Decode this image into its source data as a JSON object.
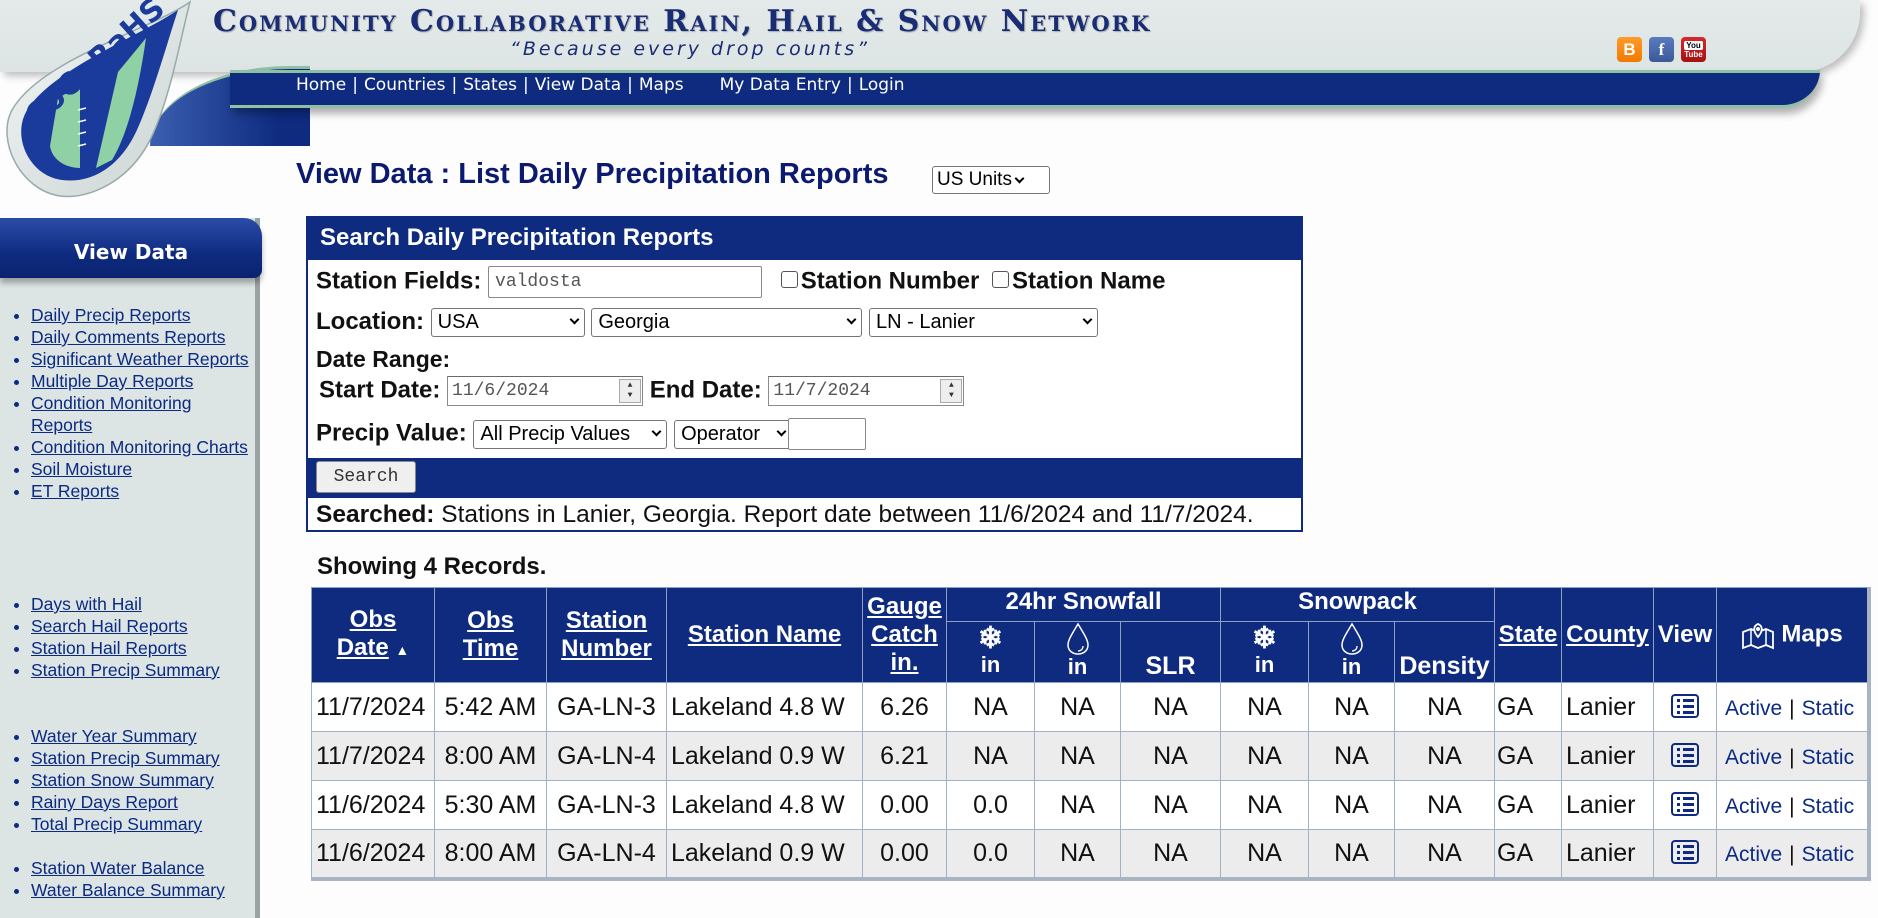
{
  "header": {
    "logo_text": "CoCoRaHS",
    "site_title": "Community Collaborative Rain, Hail & Snow Network",
    "tagline": "“Because every drop counts”",
    "nav_left": [
      "Home",
      "Countries",
      "States",
      "View Data",
      "Maps"
    ],
    "nav_right": [
      "My Data Entry",
      "Login"
    ],
    "social": [
      {
        "name": "blogger",
        "glyph": "B"
      },
      {
        "name": "facebook",
        "glyph": "f"
      },
      {
        "name": "youtube",
        "top": "You",
        "bottom": "Tube"
      }
    ]
  },
  "sidebar": {
    "title": "View Data",
    "groups": [
      [
        "Daily Precip Reports",
        "Daily Comments Reports",
        "Significant Weather Reports",
        "Multiple Day Reports",
        "Condition Monitoring Reports",
        "Condition Monitoring Charts",
        "Soil Moisture",
        "ET Reports"
      ],
      [
        "Days with Hail",
        "Search Hail Reports",
        "Station Hail Reports",
        "Station Precip Summary"
      ],
      [
        "Water Year Summary",
        "Station Precip Summary",
        "Station Snow Summary",
        "Rainy Days Report",
        "Total Precip Summary"
      ],
      [
        "Station Water Balance",
        "Water Balance Summary"
      ]
    ]
  },
  "page": {
    "title": "View Data : List Daily Precipitation Reports",
    "units_select": "US Units"
  },
  "search": {
    "heading": "Search Daily Precipitation Reports",
    "station_fields_label": "Station Fields:",
    "station_fields_value": "valdosta",
    "station_number_label": "Station Number",
    "station_number_checked": false,
    "station_name_label": "Station Name",
    "station_name_checked": false,
    "location_label": "Location:",
    "country": "USA",
    "state": "Georgia",
    "county": "LN - Lanier",
    "date_range_label": "Date Range:",
    "start_date_label": "Start Date:",
    "start_date": "11/6/2024",
    "end_date_label": "End Date:",
    "end_date": "11/7/2024",
    "precip_value_label": "Precip Value:",
    "precip_value_select": "All Precip Values",
    "operator_select": "Operator",
    "precip_amount": "",
    "search_button": "Search",
    "searched_label": "Searched:",
    "searched_text": "Stations in Lanier, Georgia. Report date between 11/6/2024 and 11/7/2024."
  },
  "results": {
    "count_text": "Showing 4 Records.",
    "headers": {
      "obs_date_1": "Obs",
      "obs_date_2": "Date",
      "sort_indicator": "▲",
      "obs_time_1": "Obs",
      "obs_time_2": "Time",
      "station_number_1": "Station",
      "station_number_2": "Number",
      "station_name": "Station Name",
      "gauge_1": "Gauge",
      "gauge_2": "Catch",
      "gauge_3": "in.",
      "snowfall_group": "24hr Snowfall",
      "snowpack_group": "Snowpack",
      "unit_in": "in",
      "slr": "SLR",
      "density": "Density",
      "state": "State",
      "county": "County",
      "view": "View",
      "maps": "Maps"
    },
    "rows": [
      {
        "obs_date": "11/7/2024",
        "obs_time": "5:42 AM",
        "station_number": "GA-LN-3",
        "station_name": "Lakeland 4.8 W",
        "gauge_catch": "6.26",
        "snowfall_in": "NA",
        "snowfall_swe": "NA",
        "slr": "NA",
        "snowpack_in": "NA",
        "snowpack_swe": "NA",
        "density": "NA",
        "state": "GA",
        "county": "Lanier",
        "maps_active": "Active",
        "maps_static": "Static"
      },
      {
        "obs_date": "11/7/2024",
        "obs_time": "8:00 AM",
        "station_number": "GA-LN-4",
        "station_name": "Lakeland 0.9 W",
        "gauge_catch": "6.21",
        "snowfall_in": "NA",
        "snowfall_swe": "NA",
        "slr": "NA",
        "snowpack_in": "NA",
        "snowpack_swe": "NA",
        "density": "NA",
        "state": "GA",
        "county": "Lanier",
        "maps_active": "Active",
        "maps_static": "Static"
      },
      {
        "obs_date": "11/6/2024",
        "obs_time": "5:30 AM",
        "station_number": "GA-LN-3",
        "station_name": "Lakeland 4.8 W",
        "gauge_catch": "0.00",
        "snowfall_in": "0.0",
        "snowfall_swe": "NA",
        "slr": "NA",
        "snowpack_in": "NA",
        "snowpack_swe": "NA",
        "density": "NA",
        "state": "GA",
        "county": "Lanier",
        "maps_active": "Active",
        "maps_static": "Static"
      },
      {
        "obs_date": "11/6/2024",
        "obs_time": "8:00 AM",
        "station_number": "GA-LN-4",
        "station_name": "Lakeland 0.9 W",
        "gauge_catch": "0.00",
        "snowfall_in": "0.0",
        "snowfall_swe": "NA",
        "slr": "NA",
        "snowpack_in": "NA",
        "snowpack_swe": "NA",
        "density": "NA",
        "state": "GA",
        "county": "Lanier",
        "maps_active": "Active",
        "maps_static": "Static"
      }
    ]
  },
  "colors": {
    "brand_navy": "#0e2b80",
    "link": "#0b2a82",
    "accent_green": "#8fc0a5",
    "sidebar_bg": "#dde4e4",
    "alt_row": "#ececec"
  }
}
